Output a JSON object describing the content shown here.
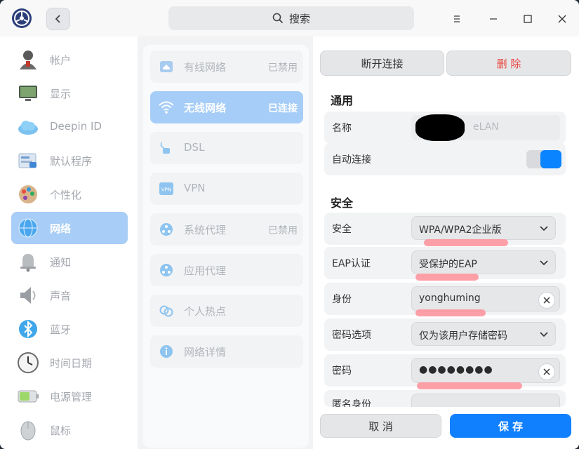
{
  "titlebar": {
    "search_label": "搜索",
    "icons": {
      "logo": "settings-logo-icon",
      "back": "chevron-left-icon",
      "search": "search-icon",
      "menu": "menu-icon",
      "maximize": "maximize-icon",
      "close": "close-icon"
    }
  },
  "sidebar": {
    "items": [
      {
        "label": "帐户",
        "icon": "account-icon"
      },
      {
        "label": "显示",
        "icon": "display-icon"
      },
      {
        "label": "Deepin ID",
        "icon": "cloud-icon"
      },
      {
        "label": "默认程序",
        "icon": "default-apps-icon"
      },
      {
        "label": "个性化",
        "icon": "palette-icon"
      },
      {
        "label": "网络",
        "icon": "network-globe-icon",
        "active": true
      },
      {
        "label": "通知",
        "icon": "bell-icon"
      },
      {
        "label": "声音",
        "icon": "speaker-icon"
      },
      {
        "label": "蓝牙",
        "icon": "bluetooth-icon"
      },
      {
        "label": "时间日期",
        "icon": "clock-icon"
      },
      {
        "label": "电源管理",
        "icon": "battery-icon"
      },
      {
        "label": "鼠标",
        "icon": "mouse-icon"
      }
    ]
  },
  "network": {
    "items": [
      {
        "label": "有线网络",
        "status": "已禁用",
        "icon": "wired-network-icon"
      },
      {
        "label": "无线网络",
        "status": "已连接",
        "icon": "wifi-icon",
        "active": true
      },
      {
        "label": "DSL",
        "status": "",
        "icon": "dsl-icon"
      },
      {
        "label": "VPN",
        "status": "",
        "icon": "vpn-icon"
      },
      {
        "label": "系统代理",
        "status": "已禁用",
        "icon": "system-proxy-icon"
      },
      {
        "label": "应用代理",
        "status": "",
        "icon": "app-proxy-icon"
      },
      {
        "label": "个人热点",
        "status": "",
        "icon": "hotspot-icon"
      },
      {
        "label": "网络详情",
        "status": "",
        "icon": "info-icon"
      }
    ]
  },
  "detail": {
    "disconnect_label": "断开连接",
    "delete_label": "删 除",
    "general_title": "通用",
    "name_label": "名称",
    "name_value": "eLAN",
    "auto_connect_label": "自动连接",
    "auto_connect_on": true,
    "security_title": "安全",
    "security_label": "安全",
    "security_value": "WPA/WPA2企业版",
    "eap_label": "EAP认证",
    "eap_value": "受保护的EAP",
    "identity_label": "身份",
    "identity_value": "yonghuming",
    "password_option_label": "密码选项",
    "password_option_value": "仅为该用户存储密码",
    "password_label": "密码",
    "password_value": "●●●●●●●●",
    "anon_identity_label": "匿名身份",
    "cancel_label": "取 消",
    "save_label": "保 存"
  },
  "colors": {
    "accent": "#1180ff",
    "active_item": "#a8cdf6",
    "delete_text": "#e9463f",
    "annotation": "#ff8f99"
  }
}
